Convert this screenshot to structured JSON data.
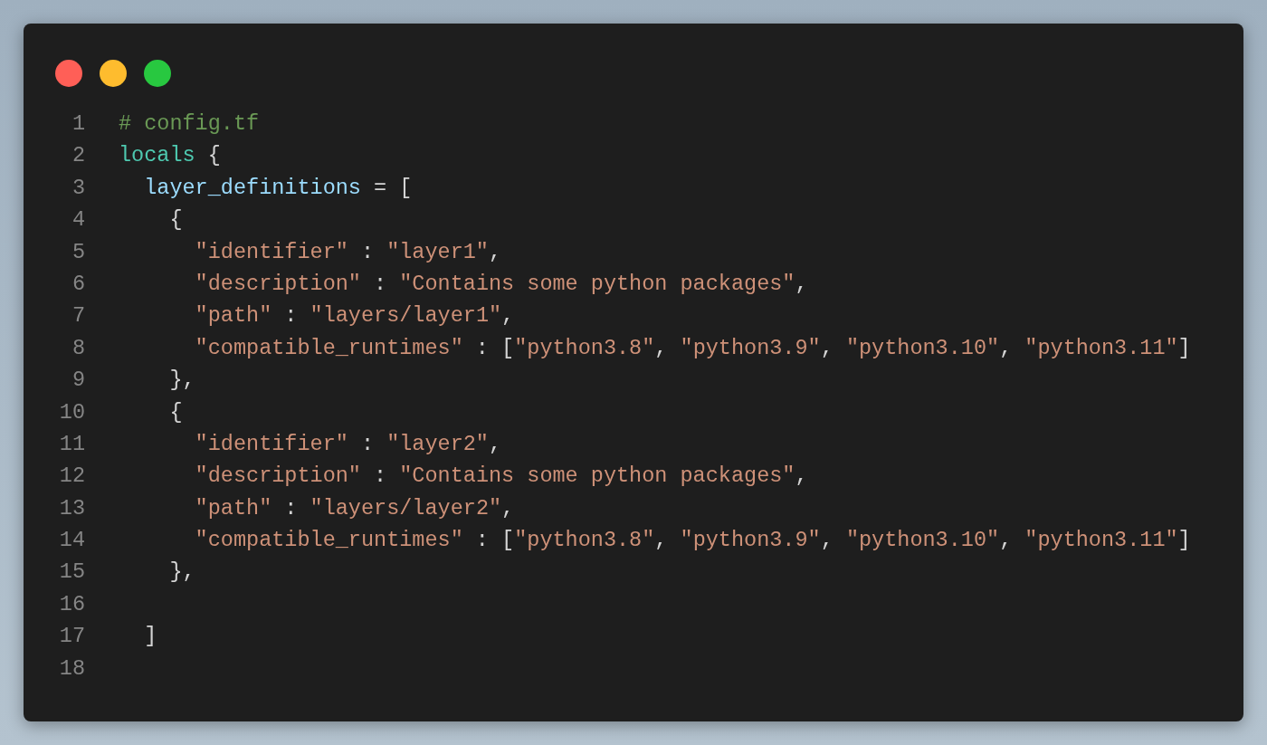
{
  "window": {
    "controls": [
      {
        "color": "#ff5f57"
      },
      {
        "color": "#febc2e"
      },
      {
        "color": "#28c840"
      }
    ]
  },
  "lines": [
    {
      "number": "1",
      "tokens": [
        {
          "kind": "comment",
          "text": "# config.tf"
        }
      ]
    },
    {
      "number": "2",
      "tokens": [
        {
          "kind": "keyword",
          "text": "locals"
        },
        {
          "kind": "punct",
          "text": " {"
        }
      ]
    },
    {
      "number": "3",
      "tokens": [
        {
          "kind": "property",
          "text": "  layer_definitions"
        },
        {
          "kind": "punct",
          "text": " = ["
        }
      ]
    },
    {
      "number": "4",
      "tokens": [
        {
          "kind": "punct",
          "text": "    {"
        }
      ]
    },
    {
      "number": "5",
      "tokens": [
        {
          "kind": "string",
          "text": "      \"identifier\""
        },
        {
          "kind": "punct",
          "text": " : "
        },
        {
          "kind": "string",
          "text": "\"layer1\""
        },
        {
          "kind": "punct",
          "text": ","
        }
      ]
    },
    {
      "number": "6",
      "tokens": [
        {
          "kind": "string",
          "text": "      \"description\""
        },
        {
          "kind": "punct",
          "text": " : "
        },
        {
          "kind": "string",
          "text": "\"Contains some python packages\""
        },
        {
          "kind": "punct",
          "text": ","
        }
      ]
    },
    {
      "number": "7",
      "tokens": [
        {
          "kind": "string",
          "text": "      \"path\""
        },
        {
          "kind": "punct",
          "text": " : "
        },
        {
          "kind": "string",
          "text": "\"layers/layer1\""
        },
        {
          "kind": "punct",
          "text": ","
        }
      ]
    },
    {
      "number": "8",
      "tokens": [
        {
          "kind": "string",
          "text": "      \"compatible_runtimes\""
        },
        {
          "kind": "punct",
          "text": " : ["
        },
        {
          "kind": "string",
          "text": "\"python3.8\""
        },
        {
          "kind": "punct",
          "text": ", "
        },
        {
          "kind": "string",
          "text": "\"python3.9\""
        },
        {
          "kind": "punct",
          "text": ", "
        },
        {
          "kind": "string",
          "text": "\"python3.10\""
        },
        {
          "kind": "punct",
          "text": ", "
        },
        {
          "kind": "string",
          "text": "\"python3.11\""
        },
        {
          "kind": "punct",
          "text": "]"
        }
      ]
    },
    {
      "number": "9",
      "tokens": [
        {
          "kind": "punct",
          "text": "    },"
        }
      ]
    },
    {
      "number": "10",
      "tokens": [
        {
          "kind": "punct",
          "text": "    {"
        }
      ]
    },
    {
      "number": "11",
      "tokens": [
        {
          "kind": "string",
          "text": "      \"identifier\""
        },
        {
          "kind": "punct",
          "text": " : "
        },
        {
          "kind": "string",
          "text": "\"layer2\""
        },
        {
          "kind": "punct",
          "text": ","
        }
      ]
    },
    {
      "number": "12",
      "tokens": [
        {
          "kind": "string",
          "text": "      \"description\""
        },
        {
          "kind": "punct",
          "text": " : "
        },
        {
          "kind": "string",
          "text": "\"Contains some python packages\""
        },
        {
          "kind": "punct",
          "text": ","
        }
      ]
    },
    {
      "number": "13",
      "tokens": [
        {
          "kind": "string",
          "text": "      \"path\""
        },
        {
          "kind": "punct",
          "text": " : "
        },
        {
          "kind": "string",
          "text": "\"layers/layer2\""
        },
        {
          "kind": "punct",
          "text": ","
        }
      ]
    },
    {
      "number": "14",
      "tokens": [
        {
          "kind": "string",
          "text": "      \"compatible_runtimes\""
        },
        {
          "kind": "punct",
          "text": " : ["
        },
        {
          "kind": "string",
          "text": "\"python3.8\""
        },
        {
          "kind": "punct",
          "text": ", "
        },
        {
          "kind": "string",
          "text": "\"python3.9\""
        },
        {
          "kind": "punct",
          "text": ", "
        },
        {
          "kind": "string",
          "text": "\"python3.10\""
        },
        {
          "kind": "punct",
          "text": ", "
        },
        {
          "kind": "string",
          "text": "\"python3.11\""
        },
        {
          "kind": "punct",
          "text": "]"
        }
      ]
    },
    {
      "number": "15",
      "tokens": [
        {
          "kind": "punct",
          "text": "    },"
        }
      ]
    },
    {
      "number": "16"
    },
    {
      "number": "17",
      "tokens": [
        {
          "kind": "punct",
          "text": "  ]"
        }
      ]
    },
    {
      "number": "18"
    }
  ]
}
